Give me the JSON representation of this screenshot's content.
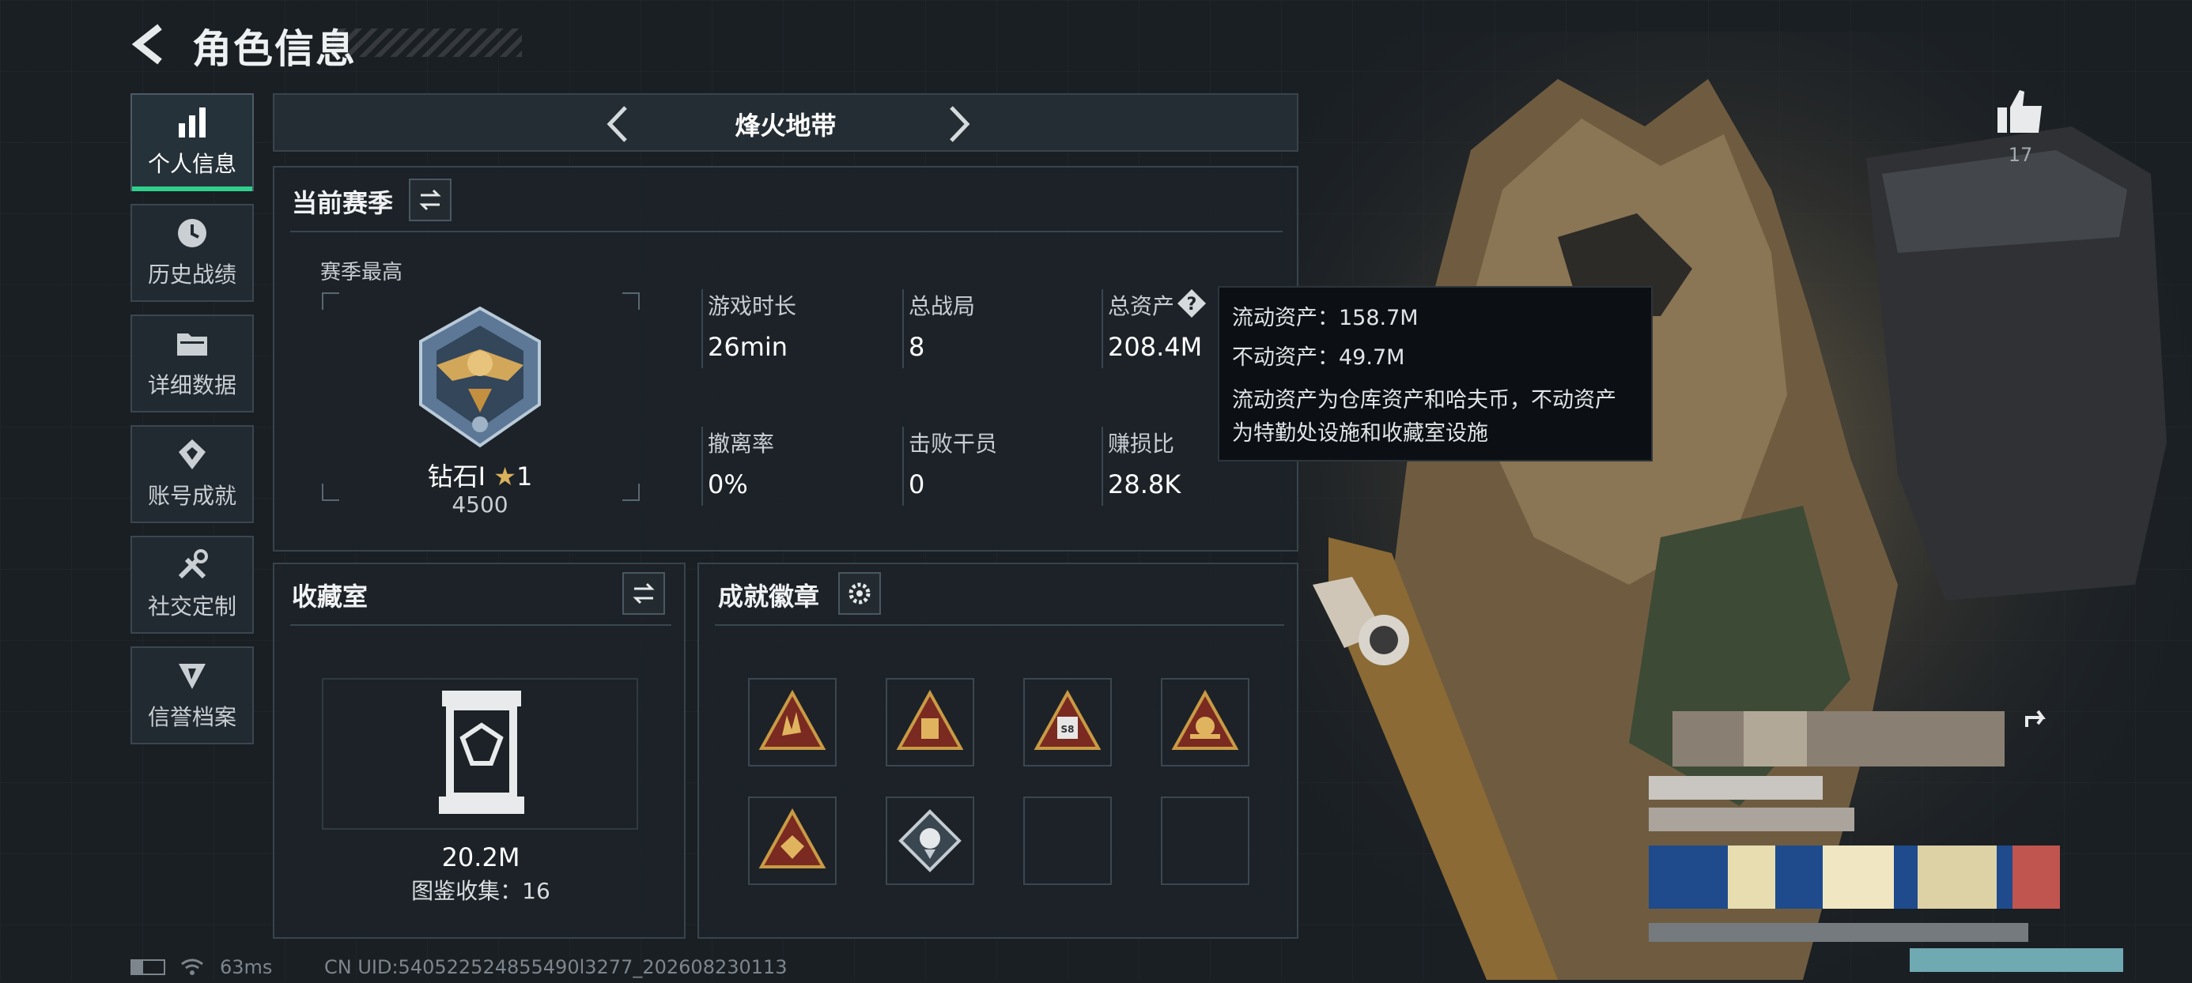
{
  "header": {
    "title": "角色信息"
  },
  "sidebar": {
    "items": [
      {
        "label": "个人信息",
        "icon": "bar-chart-icon",
        "active": true
      },
      {
        "label": "历史战绩",
        "icon": "history-clock-icon"
      },
      {
        "label": "详细数据",
        "icon": "folder-icon"
      },
      {
        "label": "账号成就",
        "icon": "achievement-icon"
      },
      {
        "label": "社交定制",
        "icon": "wrench-icon"
      },
      {
        "label": "信誉档案",
        "icon": "reputation-icon"
      }
    ]
  },
  "mode_selector": {
    "title": "烽火地带"
  },
  "season": {
    "title": "当前赛季",
    "best_label": "赛季最高",
    "rank": "钻石I",
    "stars": "1",
    "points": "4500",
    "stats": [
      {
        "label": "游戏时长",
        "value": "26min"
      },
      {
        "label": "总战局",
        "value": "8"
      },
      {
        "label": "总资产",
        "value": "208.4M"
      },
      {
        "label": "撤离率",
        "value": "0%"
      },
      {
        "label": "击败干员",
        "value": "0"
      },
      {
        "label": "赚损比",
        "value": "28.8K"
      }
    ]
  },
  "tooltip": {
    "liquid": "流动资产：158.7M",
    "fixed": "不动资产：49.7M",
    "desc_line1": "流动资产为仓库资产和哈夫币，不动资产",
    "desc_line2": "为特勤处设施和收藏室设施"
  },
  "collection": {
    "title": "收藏室",
    "value": "20.2M",
    "catalog": "图鉴收集：16"
  },
  "achievements": {
    "title": "成就徽章",
    "badges": [
      "hand-sign-badge-icon",
      "cube-badge-icon",
      "s8-badge-icon",
      "skull-badge-icon",
      "crest-badge-icon",
      "rose-badge-icon",
      "empty",
      "empty"
    ]
  },
  "likes": {
    "count": "17"
  },
  "status": {
    "ping": "63ms",
    "uid": "CN UID:540522524855490l3277_202608230113"
  },
  "colors": {
    "accent": "#2fd08c",
    "gold": "#c99a45",
    "badge_red": "#7a2a20"
  }
}
